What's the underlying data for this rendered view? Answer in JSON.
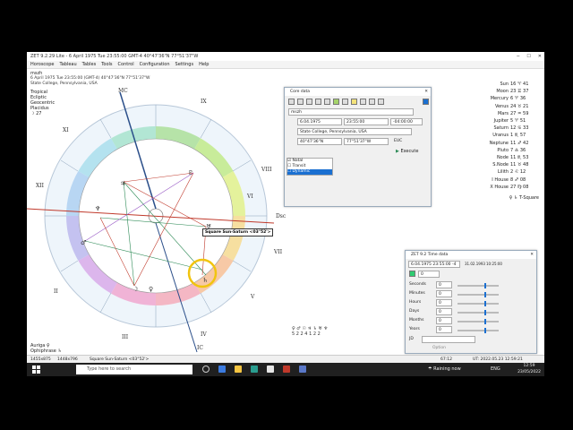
{
  "window": {
    "title": "ZET 9.2.29 Lite - 6 April 1975  Tue  23:55:00 GMT-4 40°47'36\"N  77°51'37\"W",
    "controls": [
      "─",
      "☐",
      "✕"
    ]
  },
  "menu": [
    "Horoscope",
    "Tableau",
    "Tables",
    "Tools",
    "Control",
    "Configuration",
    "Settings",
    "Help"
  ],
  "info": {
    "name": "mszh",
    "date_line": "6 April 1975  Tue  23:55:00 (GMT-4) 40°47'36\"N 77°51'37\"W",
    "place": "State College, Pennsylvania, USA",
    "tags": [
      "Tropical",
      "Ecliptic",
      "Geocentric",
      "Placidus"
    ],
    "extra": "☽ 27"
  },
  "chart": {
    "houses": [
      "IX",
      "VIII",
      "XI",
      "XII",
      "VII",
      "II",
      "III",
      "IV",
      "V",
      "VI"
    ],
    "mc": "MC",
    "ic": "IC",
    "dsc": "Dsc",
    "caption": "Square Sun-Saturn <03°52'>"
  },
  "positions": [
    {
      "planet": "Sun",
      "value": "16 ♈ 41"
    },
    {
      "planet": "Moon",
      "value": "23 ♊ 37"
    },
    {
      "planet": "Mercury",
      "value": "6 ♈ 36"
    },
    {
      "planet": "Venus",
      "value": "24 ♉ 21"
    },
    {
      "planet": "Mars",
      "value": "27 ♒ 59"
    },
    {
      "planet": "Jupiter",
      "value": "5 ♈ 51"
    },
    {
      "planet": "Saturn",
      "value": "12 ♋ 33"
    },
    {
      "planet": "Uranus",
      "value": "1 ♏ 57"
    },
    {
      "planet": "Neptune",
      "value": "11 ♐ 42"
    },
    {
      "planet": "Pluto",
      "value": "7 ♎ 36"
    },
    {
      "planet": "Node",
      "value": "11 ♏ 53"
    },
    {
      "planet": "S.Node",
      "value": "11 ♉ 48"
    },
    {
      "planet": "Lilith",
      "value": "2 ♌ 12"
    },
    {
      "planet": "I House",
      "value": "8 ♐ 08"
    },
    {
      "planet": "X House",
      "value": "27 ♍ 08"
    }
  ],
  "positions_extra": "♀ ♄ T-Square",
  "core_dialog": {
    "title": "Core data",
    "name_value": "mszh",
    "date_value": "6.04.1975",
    "time_value": "23:55:00",
    "tz_value": "-04:00:00",
    "place_value": "State College, Pennsylvania, USA",
    "lat_value": "40°47'36\"N",
    "lon_value": "77°51'37\"W",
    "utc_label": "EUC",
    "execute_label": "Execute",
    "list": [
      "Natal",
      "Transit",
      "Dynamic"
    ]
  },
  "time_dialog": {
    "title": "ZET 9.2 Time data",
    "date_value": "6.04.1975 23:55:00 -4",
    "date2": "31.02.1993",
    "time2": "10:25:00",
    "rows": [
      {
        "label": "Seconds",
        "value": "0"
      },
      {
        "label": "Minutes",
        "value": "0"
      },
      {
        "label": "Hours",
        "value": "0"
      },
      {
        "label": "Days",
        "value": "0"
      },
      {
        "label": "Months",
        "value": "0"
      },
      {
        "label": "Years",
        "value": "0"
      }
    ],
    "jd_label": "JD",
    "option_label": "Option"
  },
  "bottom_legend": [
    "Auriga ♀",
    "Ophiphrase ♄"
  ],
  "status": {
    "coord1": "1455x875",
    "coord2": "1448x796",
    "caption": "Square Sun-Saturn <03°52'>",
    "mid": "67:12",
    "right": "UT: 2022.05.23 12:59:21"
  },
  "counts": {
    "row1": "♀ ♂ ☉ ♃ ♄ ♅ ♆",
    "row2": "5 2 2 4 1 2 2"
  },
  "taskbar": {
    "search_placeholder": "Type here to search",
    "weather": "Raining now",
    "time": "12:59",
    "date": "23/05/2022",
    "lang": "ENG"
  },
  "colors": {
    "accent": "#1a6fd1",
    "taskbar": "#202020"
  }
}
